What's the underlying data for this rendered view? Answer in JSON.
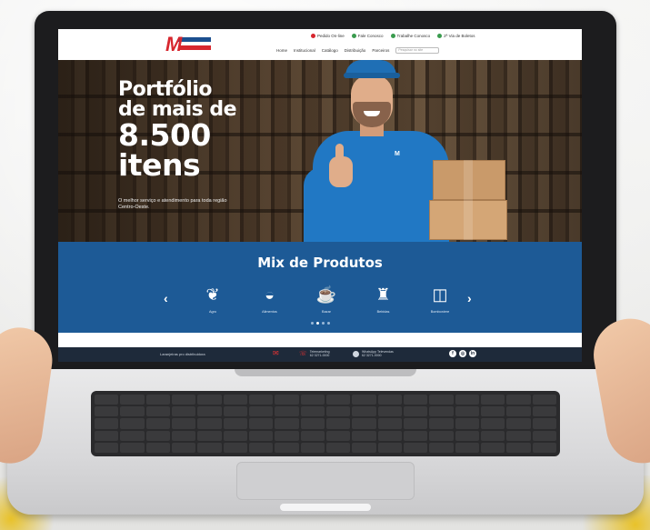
{
  "site": {
    "logo_text": "M",
    "top_links": [
      {
        "label": "Pedido On-line",
        "color": "#d7262e"
      },
      {
        "label": "Fale Conosco",
        "color": "#3a9b4e"
      },
      {
        "label": "Trabalhe Conosco",
        "color": "#3a9b4e"
      },
      {
        "label": "2ª Via de Boletos",
        "color": "#3a9b4e"
      }
    ],
    "nav": [
      "Home",
      "Institucional",
      "Catálogo",
      "Distribuição",
      "Parceiros"
    ],
    "search_placeholder": "Pesquisar no site"
  },
  "hero": {
    "title_line1": "Portfólio",
    "title_line2": "de mais de",
    "title_line3": "8.500",
    "title_line4": "itens",
    "subtitle": "O melhor serviço e atendimento para toda região Centro-Oeste.",
    "shirt_logo": "M"
  },
  "mix": {
    "title": "Mix de Produtos",
    "prev_arrow": "‹",
    "next_arrow": "›",
    "items": [
      {
        "icon": "wheat-icon",
        "glyph": "❦",
        "label": "Agro"
      },
      {
        "icon": "food-bowl-icon",
        "glyph": "◒",
        "label": "Alimentos"
      },
      {
        "icon": "cup-icon",
        "glyph": "☕",
        "label": "Bazar"
      },
      {
        "icon": "bottles-icon",
        "glyph": "♜",
        "label": "Bebidas"
      },
      {
        "icon": "jar-icon",
        "glyph": "◫",
        "label": "Bomboniere"
      }
    ]
  },
  "footer": {
    "text": "Laranjeiras pro distribuidora",
    "phone_title": "Telemarketing",
    "phone_number": "62 3271-0000",
    "whatsapp_title": "WhatsApp Televendas",
    "whatsapp_number": "62 3271-0000",
    "social": [
      "f",
      "◎",
      "in"
    ]
  }
}
